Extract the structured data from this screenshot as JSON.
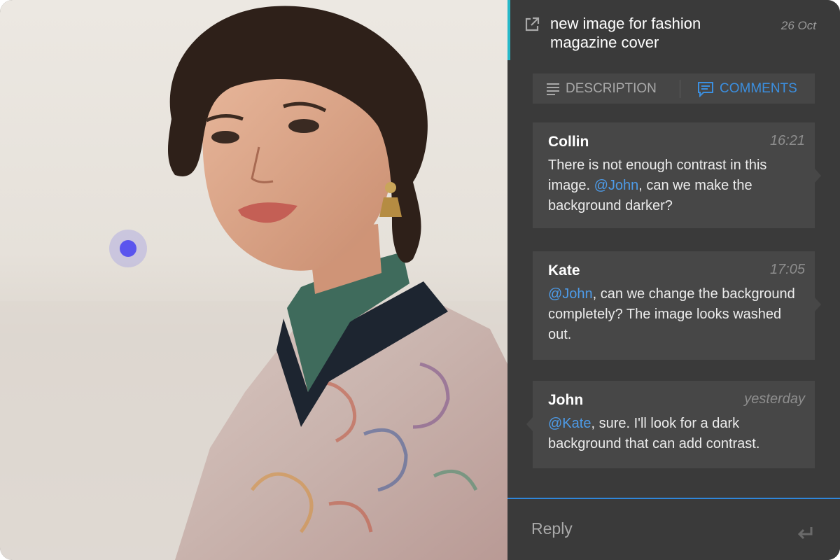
{
  "header": {
    "title": "new image for fashion magazine cover",
    "date": "26 Oct",
    "open_icon": "external-link-icon"
  },
  "tabs": [
    {
      "label": "DESCRIPTION",
      "icon": "lines-icon",
      "active": false
    },
    {
      "label": "COMMENTS",
      "icon": "comment-icon",
      "active": true
    }
  ],
  "comments": [
    {
      "author": "Collin",
      "time": "16:21",
      "text_before": "There is not enough contrast in this image. ",
      "mention": "@John",
      "text_after": ", can we make the background darker?"
    },
    {
      "author": "Kate",
      "time": "17:05",
      "text_before": "",
      "mention": "@John",
      "text_after": ", can we change the background completely? The image looks washed out."
    },
    {
      "author": "John",
      "time": "yesterday",
      "text_before": "",
      "mention": "@Kate",
      "text_after": ", sure. I'll look for a dark background that can add contrast."
    }
  ],
  "reply": {
    "placeholder": "Reply",
    "value": "",
    "submit_icon": "enter-icon"
  },
  "colors": {
    "panel_bg": "#3a3a3a",
    "card_bg": "#474747",
    "accent_blue": "#3b8fe0",
    "header_accent": "#27b8c8",
    "hotspot": "#5a55ee"
  }
}
